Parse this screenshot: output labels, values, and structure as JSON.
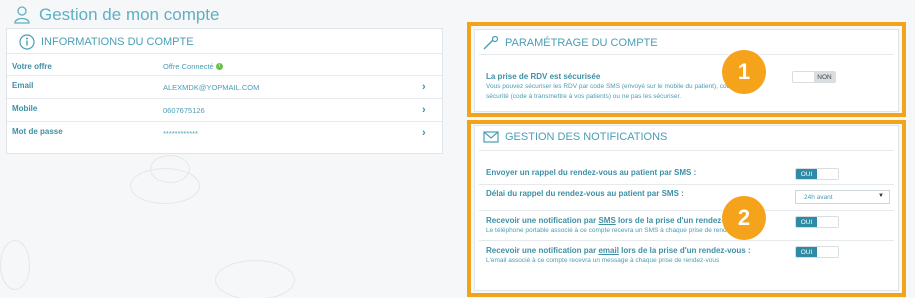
{
  "page": {
    "title": "Gestion de mon compte"
  },
  "account": {
    "title": "INFORMATIONS DU COMPTE",
    "rows": [
      {
        "label": "Votre offre",
        "value": "Offre Connecté"
      },
      {
        "label": "Email",
        "value": "ALEXMDK@YOPMAIL.COM"
      },
      {
        "label": "Mobile",
        "value": "0607675126"
      },
      {
        "label": "Mot de passe",
        "value": "************"
      }
    ]
  },
  "settings": {
    "title": "PARAMÉTRAGE DU COMPTE",
    "rdv_label": "La prise de RDV est sécurisée",
    "rdv_desc_1": "Vous pouvez sécuriser les RDV par code SMS (envoyé sur le mobile du patient), code de",
    "rdv_desc_2": "sécurité (code à transmettre à vos patients) ou ne pas les sécuriser.",
    "toggle_no": "NON"
  },
  "notifications": {
    "title": "GESTION DES NOTIFICATIONS",
    "sms_reminder_label": "Envoyer un rappel du rendez-vous au patient par SMS :",
    "delay_label": "Délai du rappel du rendez-vous au patient par SMS :",
    "delay_value": "24h avant",
    "sms_notif_label_a": "Recevoir une notification par ",
    "sms_word": "SMS",
    "sms_notif_label_b": " lors de la prise d'un rendez-vous:",
    "sms_notif_desc": "Le téléphone portable associé à ce compte recevra un SMS à chaque prise de rendez-vous",
    "email_notif_label_a": "Recevoir une notification par ",
    "email_word": "email",
    "email_notif_label_b": " lors de la prise d'un rendez-vous :",
    "email_notif_desc": "L'email associé à ce compte recevra un message à chaque prise de rendez-vous",
    "toggle_yes": "OUI"
  },
  "badges": {
    "one": "1",
    "two": "2"
  },
  "colors": {
    "accent": "#2f8aa5",
    "highlight": "#f2a31c",
    "badge": "#f5a31b",
    "success": "#6cbf4b"
  }
}
